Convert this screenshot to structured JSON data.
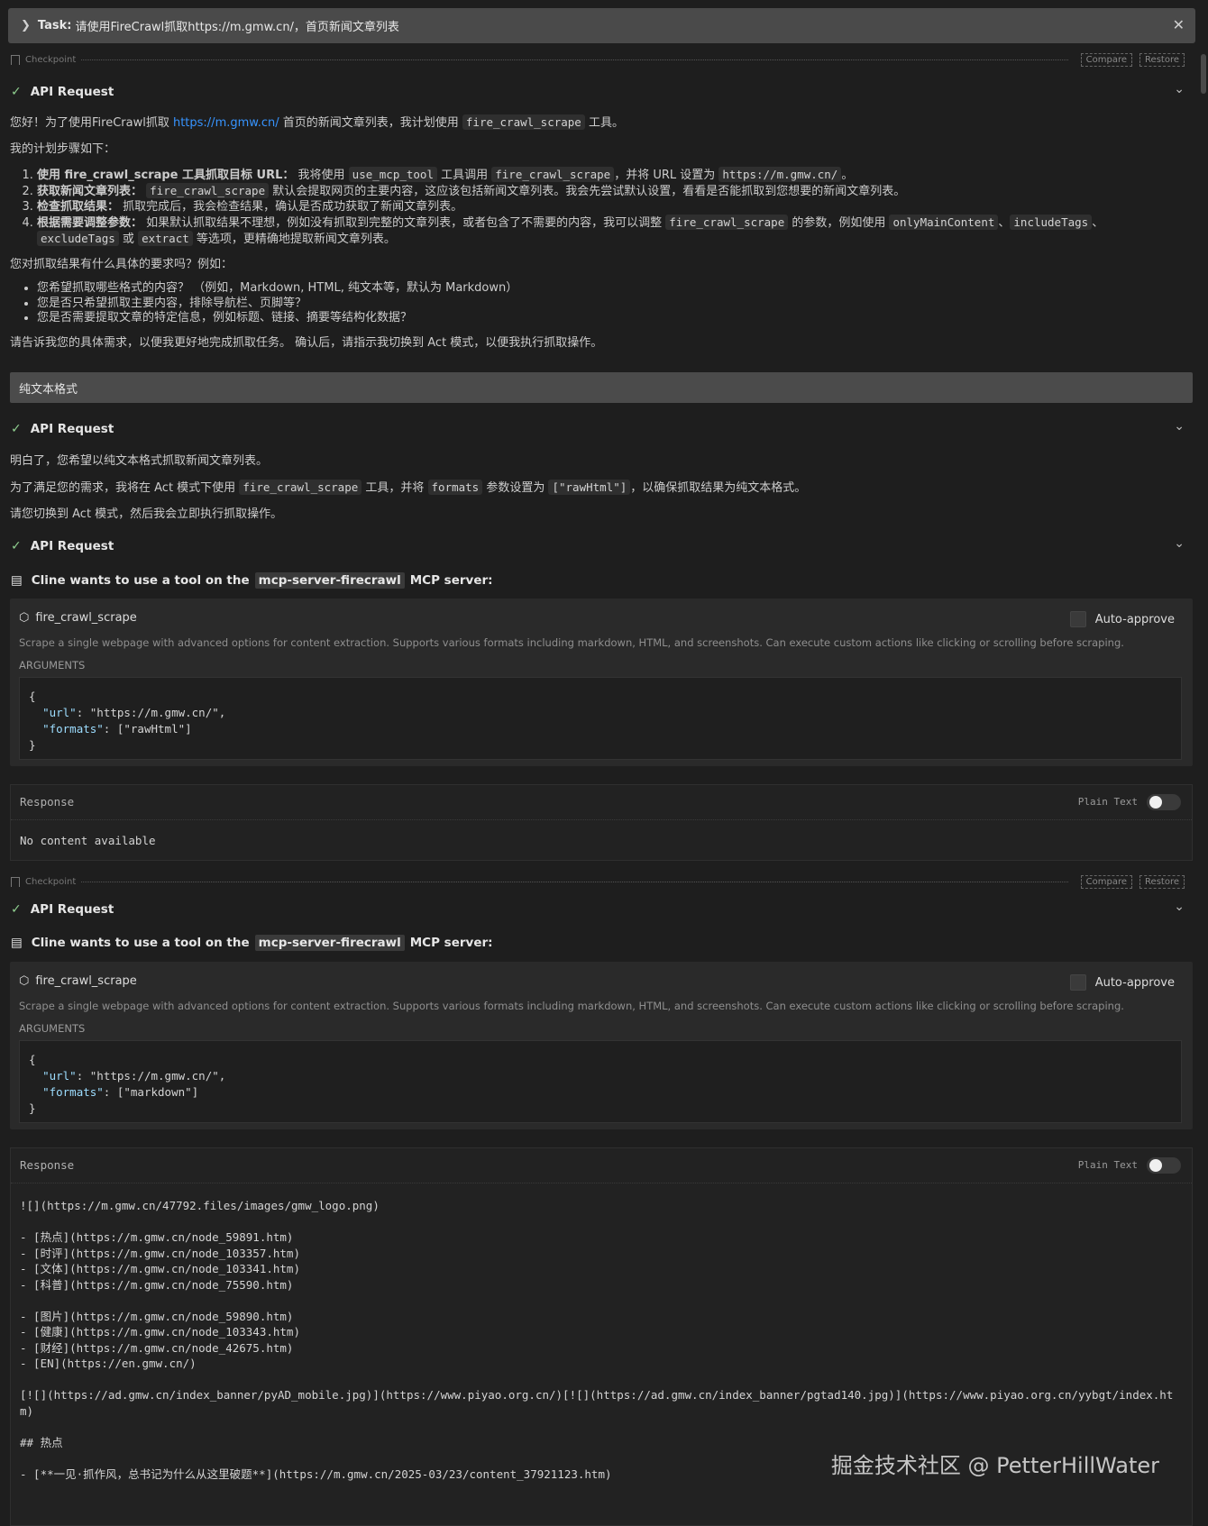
{
  "task": {
    "label": "Task:",
    "text": "请使用FireCrawl抓取https://m.gmw.cn/，首页新闻文章列表"
  },
  "checkpoint": {
    "label": "Checkpoint",
    "compare": "Compare",
    "restore": "Restore"
  },
  "api_request_label": "API Request",
  "msg1": {
    "greet_pre": "您好！为了使用FireCrawl抓取 ",
    "greet_link": "https://m.gmw.cn/",
    "greet_mid": " 首页的新闻文章列表，我计划使用 ",
    "greet_code": "fire_crawl_scrape",
    "greet_post": " 工具。",
    "plan_title": "我的计划步骤如下：",
    "s1_bold": "使用 fire_crawl_scrape 工具抓取目标 URL：",
    "s1_a": " 我将使用 ",
    "s1_code1": "use_mcp_tool",
    "s1_b": " 工具调用 ",
    "s1_code2": "fire_crawl_scrape",
    "s1_c": "，并将 URL 设置为 ",
    "s1_code3": "https://m.gmw.cn/",
    "s1_d": "。",
    "s2_bold": "获取新闻文章列表：",
    "s2_code": "fire_crawl_scrape",
    "s2_text": " 默认会提取网页的主要内容，这应该包括新闻文章列表。我会先尝试默认设置，看看是否能抓取到您想要的新闻文章列表。",
    "s3_bold": "检查抓取结果：",
    "s3_text": " 抓取完成后，我会检查结果，确认是否成功获取了新闻文章列表。",
    "s4_bold": "根据需要调整参数：",
    "s4_a": " 如果默认抓取结果不理想，例如没有抓取到完整的文章列表，或者包含了不需要的内容，我可以调整 ",
    "s4_code1": "fire_crawl_scrape",
    "s4_b": " 的参数，例如使用 ",
    "s4_code2": "onlyMainContent",
    "s4_c": "、",
    "s4_code3": "includeTags",
    "s4_d": "、",
    "s4_code4": "excludeTags",
    "s4_e": " 或 ",
    "s4_code5": "extract",
    "s4_f": " 等选项，更精确地提取新闻文章列表。",
    "ask": "您对抓取结果有什么具体的要求吗？例如：",
    "q1": "您希望抓取哪些格式的内容？ （例如，Markdown, HTML, 纯文本等，默认为 Markdown）",
    "q2": "您是否只希望抓取主要内容，排除导航栏、页脚等？",
    "q3": "您是否需要提取文章的特定信息，例如标题、链接、摘要等结构化数据？",
    "end": "请告诉我您的具体需求，以便我更好地完成抓取任务。 确认后，请指示我切换到 Act 模式，以便我执行抓取操作。"
  },
  "user_msg": "纯文本格式",
  "msg2": {
    "l1": "明白了，您希望以纯文本格式抓取新闻文章列表。",
    "l2_a": "为了满足您的需求，我将在 Act 模式下使用 ",
    "l2_code1": "fire_crawl_scrape",
    "l2_b": " 工具，并将 ",
    "l2_code2": "formats",
    "l2_c": " 参数设置为 ",
    "l2_code3": "[\"rawHtml\"]",
    "l2_d": "，以确保抓取结果为纯文本格式。",
    "l3": "请您切换到 Act 模式，然后我会立即执行抓取操作。"
  },
  "cline": {
    "pre": "Cline wants to use a tool on the",
    "server": "mcp-server-firecrawl",
    "post": "MCP server:"
  },
  "tool": {
    "name": "fire_crawl_scrape",
    "auto_approve": "Auto-approve",
    "description": "Scrape a single webpage with advanced options for content extraction. Supports various formats including markdown, HTML, and screenshots. Can execute custom actions like clicking or scrolling before scraping.",
    "arguments_label": "ARGUMENTS"
  },
  "call1": {
    "url_key": "\"url\"",
    "url_val": "\"https://m.gmw.cn/\",",
    "fmt_key": "\"formats\"",
    "fmt_val": "[\"rawHtml\"]"
  },
  "call2": {
    "url_key": "\"url\"",
    "url_val": "\"https://m.gmw.cn/\",",
    "fmt_key": "\"formats\"",
    "fmt_val": "[\"markdown\"]"
  },
  "response": {
    "label": "Response",
    "plain_text": "Plain Text"
  },
  "resp1_body": "No content available",
  "resp2_body": "![](https://m.gmw.cn/47792.files/images/gmw_logo.png)\n\n- [热点](https://m.gmw.cn/node_59891.htm)\n- [时评](https://m.gmw.cn/node_103357.htm)\n- [文体](https://m.gmw.cn/node_103341.htm)\n- [科普](https://m.gmw.cn/node_75590.htm)\n\n- [图片](https://m.gmw.cn/node_59890.htm)\n- [健康](https://m.gmw.cn/node_103343.htm)\n- [财经](https://m.gmw.cn/node_42675.htm)\n- [EN](https://en.gmw.cn/)\n\n[![](https://ad.gmw.cn/index_banner/pyAD_mobile.jpg)](https://www.piyao.org.cn/)[![](https://ad.gmw.cn/index_banner/pgtad140.jpg)](https://www.piyao.org.cn/yybgt/index.htm)\n\n## 热点\n\n- [**一见·抓作风，总书记为什么从这里破题**](https://m.gmw.cn/2025-03/23/content_37921123.htm)",
  "watermark": "掘金技术社区 @ PetterHillWater"
}
